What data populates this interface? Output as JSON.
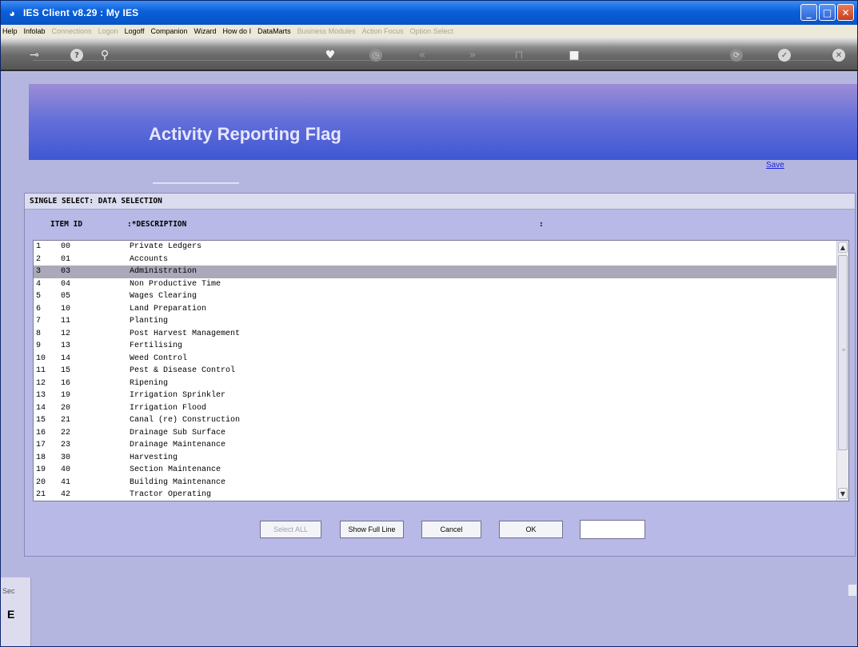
{
  "window": {
    "title": "IES Client v8.29 : My IES",
    "controls": [
      "_",
      "□",
      "✕"
    ]
  },
  "menu": [
    {
      "label": "Help",
      "enabled": true
    },
    {
      "label": "Infolab",
      "enabled": true
    },
    {
      "label": "Connections",
      "enabled": false
    },
    {
      "label": "Logon",
      "enabled": false
    },
    {
      "label": "Logoff",
      "enabled": true
    },
    {
      "label": "Companion",
      "enabled": true
    },
    {
      "label": "Wizard",
      "enabled": true
    },
    {
      "label": "How do I",
      "enabled": true
    },
    {
      "label": "DataMarts",
      "enabled": true
    },
    {
      "label": "Business Modules",
      "enabled": false
    },
    {
      "label": "Action Focus",
      "enabled": false
    },
    {
      "label": "Option Select",
      "enabled": false
    }
  ],
  "toolbar": {
    "icons": [
      "key-icon",
      "help-icon",
      "search-icon",
      "heart-icon",
      "clock-icon",
      "back-icon",
      "forward-icon",
      "stop-icon",
      "square-icon",
      "refresh-icon",
      "check-icon",
      "close-icon"
    ]
  },
  "banner": {
    "title": "Activity Reporting Flag"
  },
  "save_link": "Save",
  "dialog": {
    "title": "SINGLE SELECT: DATA SELECTION",
    "col_item_id": "ITEM ID",
    "col_description": ":*DESCRIPTION",
    "col_extra": ":",
    "rows": [
      {
        "no": "1",
        "id": "00",
        "desc": "Private Ledgers"
      },
      {
        "no": "2",
        "id": "01",
        "desc": "Accounts"
      },
      {
        "no": "3",
        "id": "03",
        "desc": "Administration"
      },
      {
        "no": "4",
        "id": "04",
        "desc": "Non Productive Time"
      },
      {
        "no": "5",
        "id": "05",
        "desc": "Wages Clearing"
      },
      {
        "no": "6",
        "id": "10",
        "desc": "Land Preparation"
      },
      {
        "no": "7",
        "id": "11",
        "desc": "Planting"
      },
      {
        "no": "8",
        "id": "12",
        "desc": "Post Harvest Management"
      },
      {
        "no": "9",
        "id": "13",
        "desc": "Fertilising"
      },
      {
        "no": "10",
        "id": "14",
        "desc": "Weed Control"
      },
      {
        "no": "11",
        "id": "15",
        "desc": "Pest & Disease Control"
      },
      {
        "no": "12",
        "id": "16",
        "desc": "Ripening"
      },
      {
        "no": "13",
        "id": "19",
        "desc": "Irrigation Sprinkler"
      },
      {
        "no": "14",
        "id": "20",
        "desc": "Irrigation Flood"
      },
      {
        "no": "15",
        "id": "21",
        "desc": "Canal (re) Construction"
      },
      {
        "no": "16",
        "id": "22",
        "desc": "Drainage Sub Surface"
      },
      {
        "no": "17",
        "id": "23",
        "desc": "Drainage Maintenance"
      },
      {
        "no": "18",
        "id": "30",
        "desc": "Harvesting"
      },
      {
        "no": "19",
        "id": "40",
        "desc": "Section Maintenance"
      },
      {
        "no": "20",
        "id": "41",
        "desc": "Building Maintenance"
      },
      {
        "no": "21",
        "id": "42",
        "desc": "Tractor Operating"
      }
    ],
    "selected_row": 2,
    "buttons": {
      "select_all": "Select ALL",
      "show_full_line": "Show Full Line",
      "cancel": "Cancel",
      "ok": "OK"
    }
  },
  "side_panel": {
    "text": "Sec",
    "glyph": "E"
  }
}
